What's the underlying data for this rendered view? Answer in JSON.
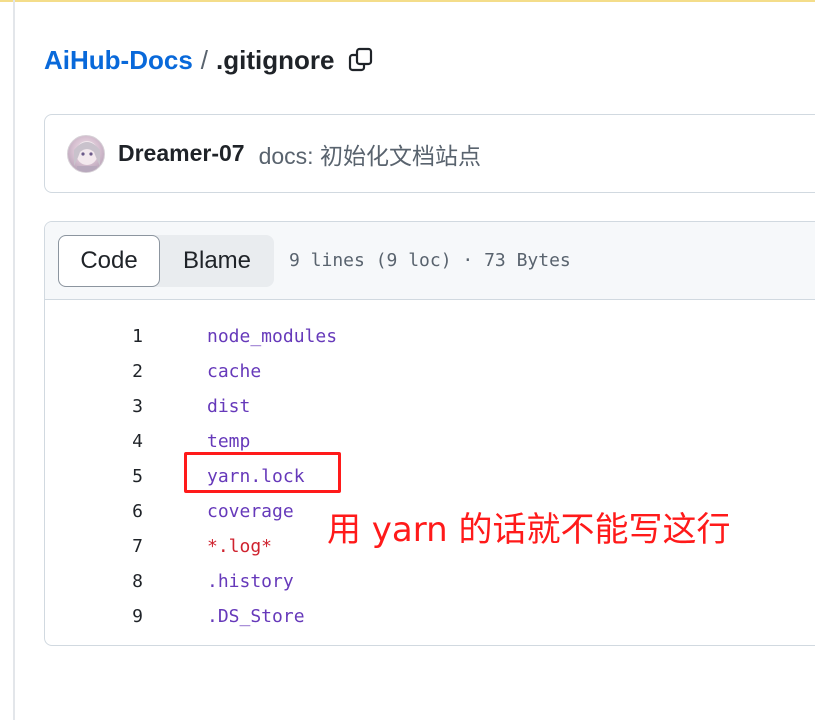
{
  "breadcrumb": {
    "repo": "AiHub-Docs",
    "separator": "/",
    "file": ".gitignore"
  },
  "commit": {
    "author": "Dreamer-07",
    "message": "docs: 初始化文档站点"
  },
  "file_header": {
    "tabs": [
      {
        "label": "Code",
        "active": true
      },
      {
        "label": "Blame",
        "active": false
      }
    ],
    "meta": "9 lines (9 loc) · 73 Bytes"
  },
  "code_lines": [
    {
      "num": "1",
      "text": "node_modules"
    },
    {
      "num": "2",
      "text": "cache"
    },
    {
      "num": "3",
      "text": "dist"
    },
    {
      "num": "4",
      "text": "temp"
    },
    {
      "num": "5",
      "text": "yarn.lock"
    },
    {
      "num": "6",
      "text": "coverage"
    },
    {
      "num": "7",
      "text": "*.log*"
    },
    {
      "num": "8",
      "text": ".history"
    },
    {
      "num": "9",
      "text": ".DS_Store"
    }
  ],
  "annotation": {
    "text": "用 yarn 的话就不能写这行",
    "color": "#ff1a1a"
  },
  "colors": {
    "link": "#0969da",
    "code_text": "#6639ba",
    "code_pattern": "#cf222e"
  },
  "icons": [
    "copy-icon",
    "avatar"
  ]
}
